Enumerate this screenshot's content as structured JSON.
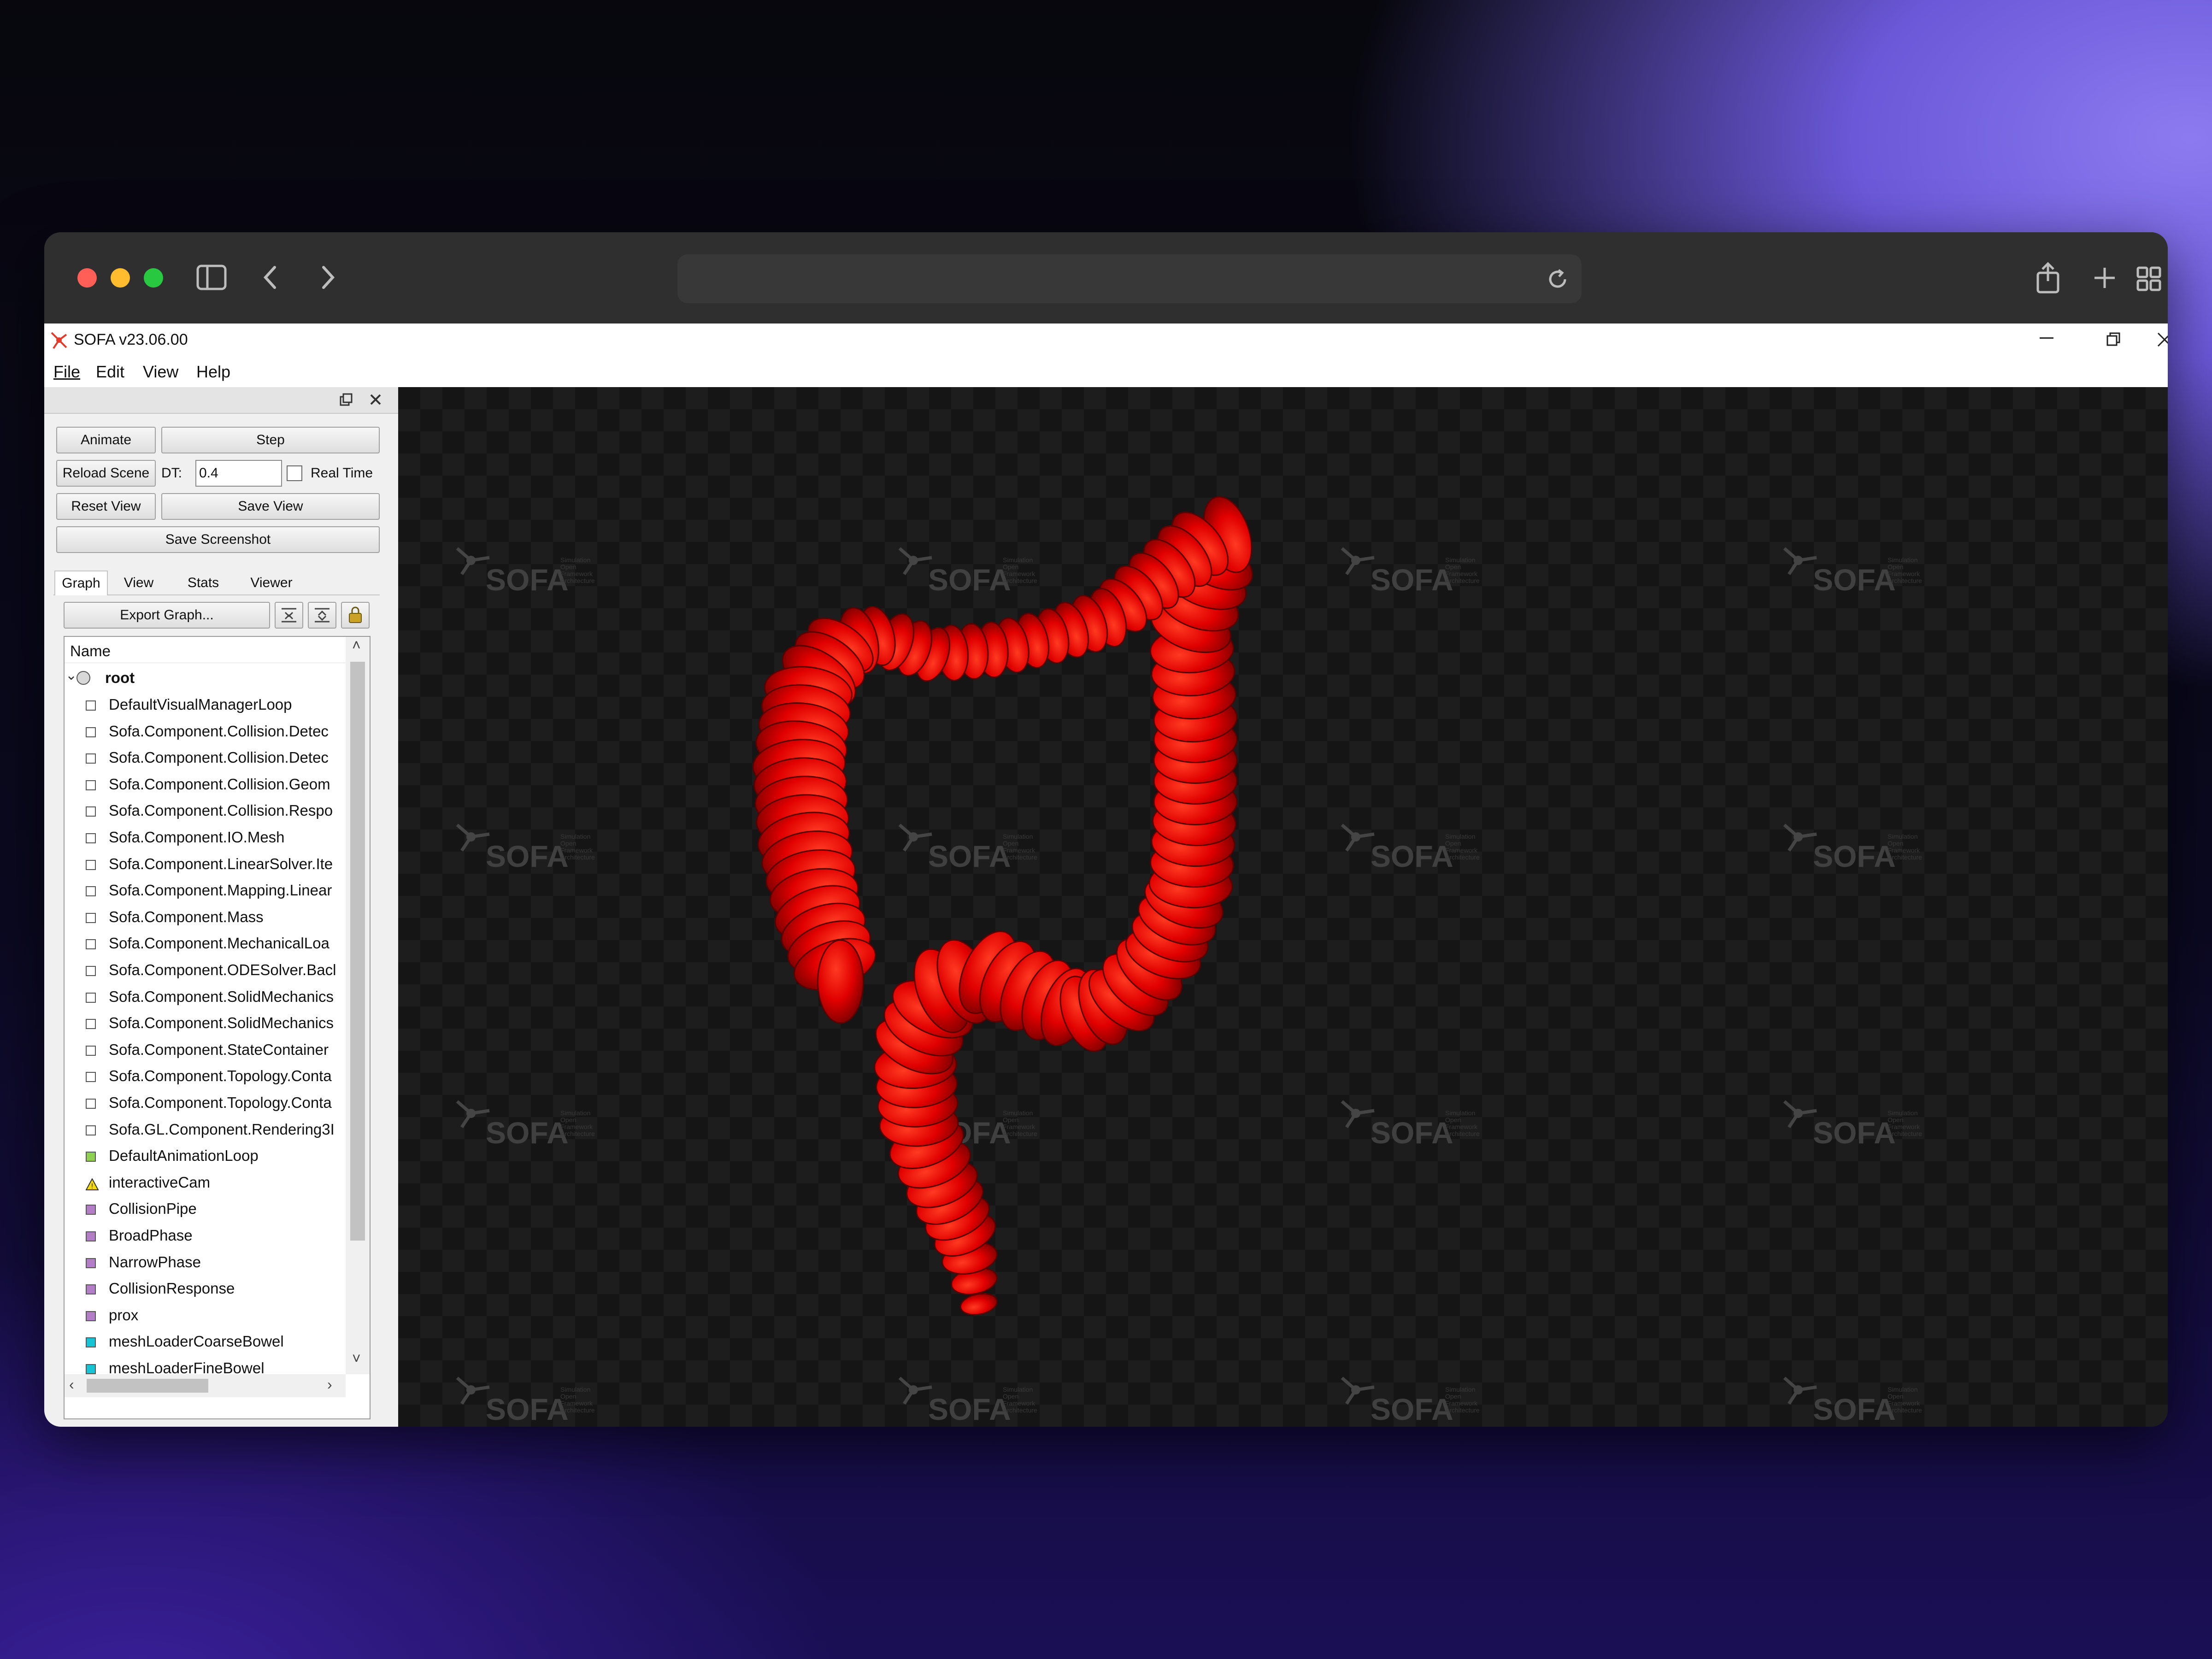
{
  "app": {
    "title": "SOFA v23.06.00",
    "menu": [
      "File",
      "Edit",
      "View",
      "Help"
    ]
  },
  "controls": {
    "animate": "Animate",
    "step": "Step",
    "reload_scene": "Reload Scene",
    "dt_label": "DT:",
    "dt_value": "0.4",
    "real_time": "Real Time",
    "reset_view": "Reset View",
    "save_view": "Save View",
    "save_screenshot": "Save Screenshot"
  },
  "tabs": [
    "Graph",
    "View",
    "Stats",
    "Viewer"
  ],
  "graph": {
    "export": "Export Graph...",
    "header": "Name",
    "root": "root",
    "items": [
      {
        "label": "DefaultVisualManagerLoop",
        "color": "#ffffff"
      },
      {
        "label": "Sofa.Component.Collision.Detec",
        "color": "#ffffff"
      },
      {
        "label": "Sofa.Component.Collision.Detec",
        "color": "#ffffff"
      },
      {
        "label": "Sofa.Component.Collision.Geom",
        "color": "#ffffff"
      },
      {
        "label": "Sofa.Component.Collision.Respo",
        "color": "#ffffff"
      },
      {
        "label": "Sofa.Component.IO.Mesh",
        "color": "#ffffff"
      },
      {
        "label": "Sofa.Component.LinearSolver.Ite",
        "color": "#ffffff"
      },
      {
        "label": "Sofa.Component.Mapping.Linear",
        "color": "#ffffff"
      },
      {
        "label": "Sofa.Component.Mass",
        "color": "#ffffff"
      },
      {
        "label": "Sofa.Component.MechanicalLoa",
        "color": "#ffffff"
      },
      {
        "label": "Sofa.Component.ODESolver.Bacl",
        "color": "#ffffff"
      },
      {
        "label": "Sofa.Component.SolidMechanics",
        "color": "#ffffff"
      },
      {
        "label": "Sofa.Component.SolidMechanics",
        "color": "#ffffff"
      },
      {
        "label": "Sofa.Component.StateContainer",
        "color": "#ffffff"
      },
      {
        "label": "Sofa.Component.Topology.Conta",
        "color": "#ffffff"
      },
      {
        "label": "Sofa.Component.Topology.Conta",
        "color": "#ffffff"
      },
      {
        "label": "Sofa.GL.Component.Rendering3I",
        "color": "#ffffff"
      },
      {
        "label": "DefaultAnimationLoop",
        "color": "#8fd14f"
      },
      {
        "label": "interactiveCam",
        "color": "#f5d90a",
        "warning": true
      },
      {
        "label": "CollisionPipe",
        "color": "#b27fc6"
      },
      {
        "label": "BroadPhase",
        "color": "#b27fc6"
      },
      {
        "label": "NarrowPhase",
        "color": "#b27fc6"
      },
      {
        "label": "CollisionResponse",
        "color": "#b27fc6"
      },
      {
        "label": "prox",
        "color": "#b27fc6"
      },
      {
        "label": "meshLoaderCoarseBowel",
        "color": "#19c3d6"
      },
      {
        "label": "meshLoaderFineBowel",
        "color": "#19c3d6"
      }
    ]
  },
  "watermark": {
    "logo": "SOFA",
    "sub": [
      "Simulation",
      "Open",
      "Framework",
      "Architecture"
    ]
  },
  "colors": {
    "model": "#e00000",
    "accent_close": "#ff5f57",
    "accent_min": "#febc2e",
    "accent_max": "#28c840"
  }
}
